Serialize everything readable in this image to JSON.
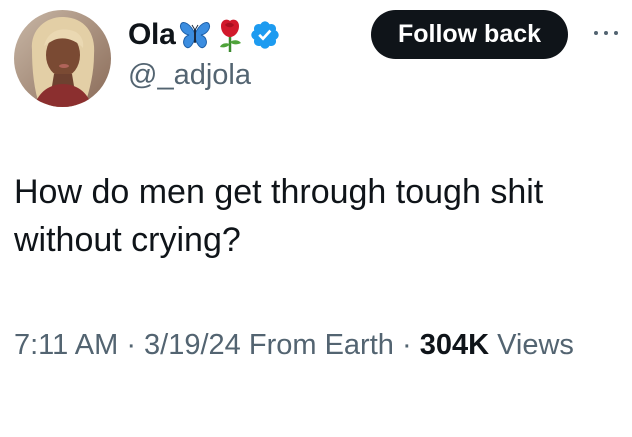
{
  "tweet": {
    "author": {
      "display_name": "Ola",
      "handle": "@_adjola",
      "name_emojis": [
        "blue-butterfly-icon",
        "red-rose-icon"
      ],
      "verified": true,
      "verified_color": "#1d9bf0"
    },
    "follow_back_label": "Follow back",
    "text": "How do men get through tough shit without crying?",
    "meta": {
      "time": "7:11 AM",
      "separator": "·",
      "date": "3/19/24",
      "source": "From Earth",
      "views_count": "304K",
      "views_label": "Views"
    }
  },
  "colors": {
    "text_primary": "#0f1419",
    "text_secondary": "#536471",
    "button_bg": "#0f1419",
    "button_text": "#ffffff",
    "verified_blue": "#1d9bf0"
  }
}
